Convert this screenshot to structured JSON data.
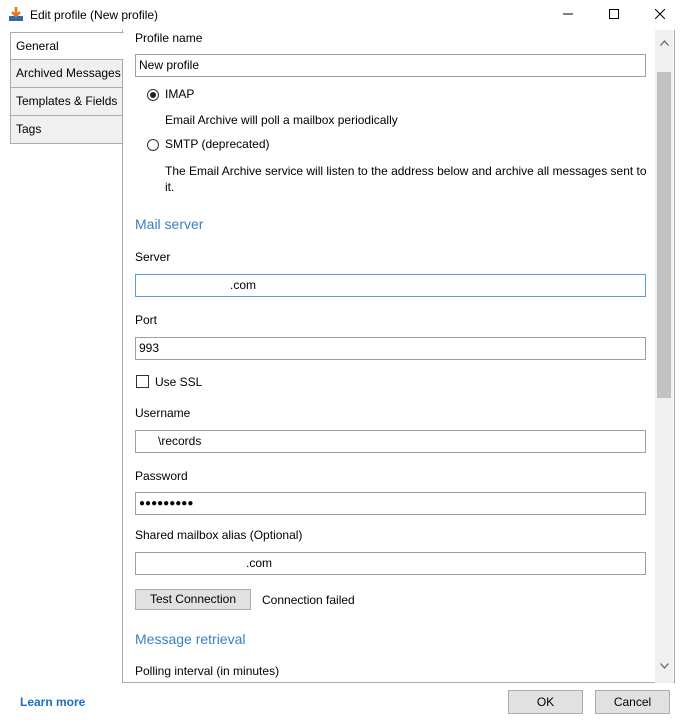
{
  "window": {
    "title": "Edit profile (New profile)",
    "icon": "download-arrow-icon",
    "controls": {
      "minimize": "minimize-icon",
      "maximize": "maximize-icon",
      "close": "close-icon"
    }
  },
  "tabs": [
    {
      "label": "General",
      "active": true
    },
    {
      "label": "Archived Messages",
      "active": false
    },
    {
      "label": "Templates & Fields",
      "active": false
    },
    {
      "label": "Tags",
      "active": false
    }
  ],
  "general": {
    "profile_name_label": "Profile name",
    "profile_name_value": "New profile",
    "imap": {
      "label": "IMAP",
      "checked": true,
      "description": "Email Archive will poll a mailbox periodically"
    },
    "smtp": {
      "label": "SMTP (deprecated)",
      "checked": false,
      "description": "The Email Archive service will listen to the address below and archive all messages sent to it."
    },
    "mail_server_heading": "Mail server",
    "server_label": "Server",
    "server_value": ".com",
    "port_label": "Port",
    "port_value": "993",
    "use_ssl_label": "Use SSL",
    "use_ssl_checked": false,
    "username_label": "Username",
    "username_value": "\\records",
    "password_label": "Password",
    "password_value": "●●●●●●●●●",
    "shared_alias_label": "Shared mailbox alias (Optional)",
    "shared_alias_value": ".com",
    "test_connection_label": "Test Connection",
    "connection_status": "Connection failed",
    "message_retrieval_heading": "Message retrieval",
    "polling_interval_label": "Polling interval (in minutes)"
  },
  "footer": {
    "learn_more": "Learn more",
    "ok": "OK",
    "cancel": "Cancel"
  },
  "colors": {
    "accent": "#3a7fc1",
    "link": "#1a6fbf",
    "focus_border": "#569de5"
  }
}
